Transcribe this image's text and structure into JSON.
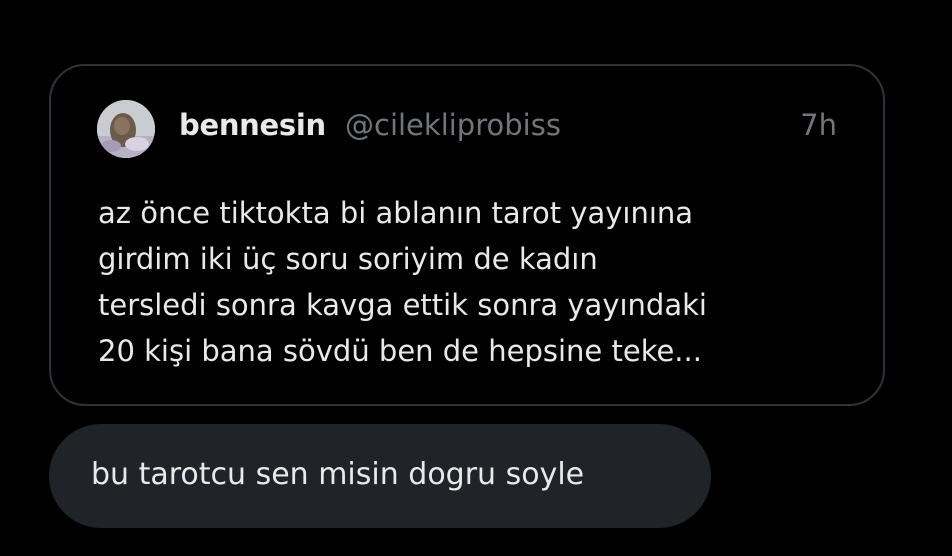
{
  "quoted_post": {
    "author_name": "bennesin",
    "author_handle": "@cilekliprobiss",
    "time": "7h",
    "text_lines": [
      "az önce tiktokta bi ablanın tarot yayınına",
      "girdim iki üç soru soriyim de kadın",
      "tersledi sonra kavga ettik sonra yayındaki",
      "20 kişi bana sövdü ben de hepsine teke..."
    ],
    "avatar": "profile-photo"
  },
  "reply": {
    "text": "bu tarotcu sen misin dogru soyle"
  },
  "colors": {
    "background": "#000000",
    "card_border": "#2f3336",
    "primary_text": "#e7e9ea",
    "secondary_text": "#71767b",
    "bubble": "#202327"
  }
}
